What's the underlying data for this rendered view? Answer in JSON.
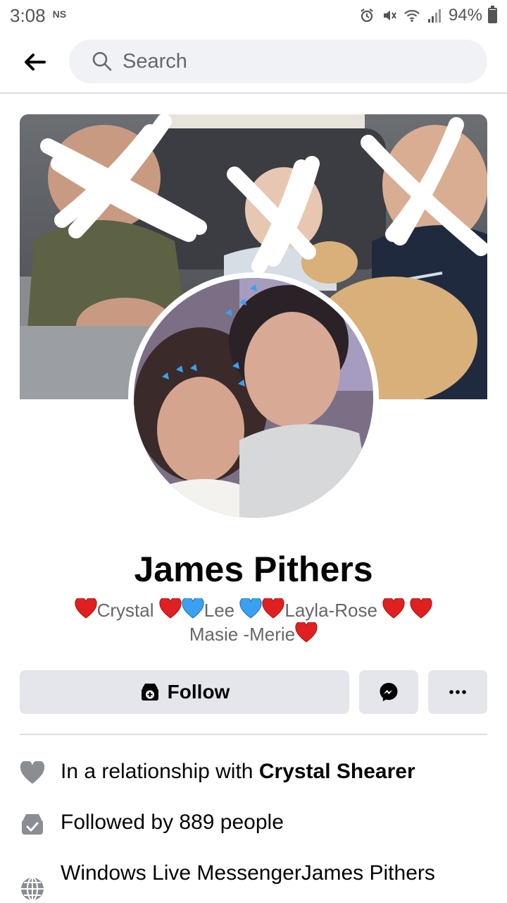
{
  "status_bar": {
    "time": "3:08",
    "carrier_tag": "NS",
    "battery": "94%",
    "battery_level": 0.94
  },
  "search": {
    "placeholder": "Search"
  },
  "profile": {
    "name": "James Pithers",
    "bio": {
      "crystal": "Crystal",
      "lee": "Lee",
      "layla_rose": "Layla-Rose",
      "masie": "Masie -Merie"
    }
  },
  "actions": {
    "follow_label": "Follow"
  },
  "intro": {
    "relationship_prefix": "In a relationship with ",
    "relationship_name": "Crystal Shearer",
    "followers": "Followed by 889 people",
    "website": "Windows Live MessengerJames Pithers"
  },
  "colors": {
    "accent": "#1877f2",
    "button_bg": "#e4e6eb",
    "secondary_text": "#65676b",
    "heart_red": "#e02020",
    "heart_blue": "#3aa0f0"
  },
  "icons": {
    "back": "arrow-left-icon",
    "search": "search-icon",
    "follow": "follow-plus-icon",
    "messenger": "messenger-icon",
    "more": "more-dots-icon",
    "relationship": "heart-icon",
    "followers": "followers-check-icon",
    "website": "globe-icon"
  }
}
